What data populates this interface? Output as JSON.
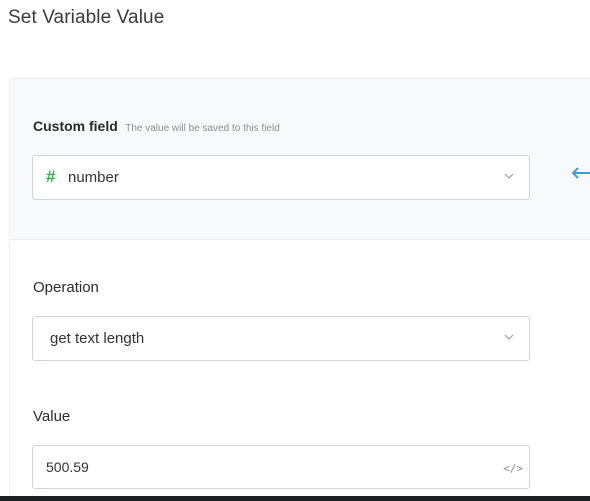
{
  "header": {
    "title": "Set Variable Value"
  },
  "custom_field": {
    "label": "Custom field",
    "hint": "The value will be saved to this field",
    "selected_value": "number",
    "type_icon": "hash-icon",
    "type_color": "#2fb84a"
  },
  "operation": {
    "label": "Operation",
    "selected_value": "get text length"
  },
  "value": {
    "label": "Value",
    "current_value": "500.59",
    "code_icon_glyph": "</>"
  },
  "colors": {
    "connector_arrow": "#3b9be0",
    "border": "#cfd4da"
  }
}
